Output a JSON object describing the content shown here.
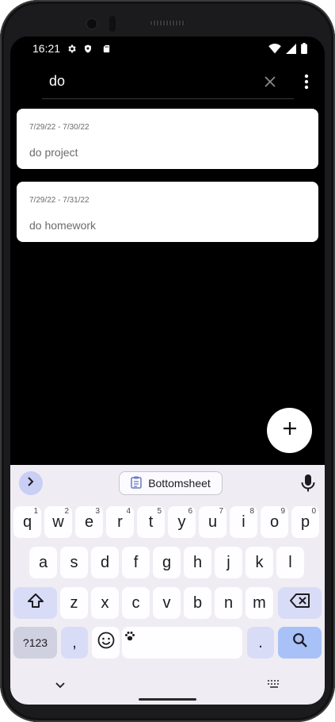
{
  "status_bar": {
    "time": "16:21",
    "icons": [
      "settings-icon",
      "shield-icon",
      "sd-card-icon",
      "wifi-icon",
      "signal-icon",
      "battery-icon"
    ]
  },
  "search": {
    "query": "do",
    "icons": [
      "close-icon",
      "more-vertical-icon"
    ]
  },
  "results": [
    {
      "dates": "7/29/22  -  7/30/22",
      "title": "do project"
    },
    {
      "dates": "7/29/22  -  7/31/22",
      "title": "do homework"
    }
  ],
  "fab": {
    "icon": "plus-icon"
  },
  "keyboard": {
    "clipboard_chip": "Bottomsheet",
    "row1": [
      {
        "k": "q",
        "s": "1"
      },
      {
        "k": "w",
        "s": "2"
      },
      {
        "k": "e",
        "s": "3"
      },
      {
        "k": "r",
        "s": "4"
      },
      {
        "k": "t",
        "s": "5"
      },
      {
        "k": "y",
        "s": "6"
      },
      {
        "k": "u",
        "s": "7"
      },
      {
        "k": "i",
        "s": "8"
      },
      {
        "k": "o",
        "s": "9"
      },
      {
        "k": "p",
        "s": "0"
      }
    ],
    "row2": [
      "a",
      "s",
      "d",
      "f",
      "g",
      "h",
      "j",
      "k",
      "l"
    ],
    "row3": [
      "z",
      "x",
      "c",
      "v",
      "b",
      "n",
      "m"
    ],
    "symbols_key": "?123",
    "comma_key": ",",
    "period_key": ".",
    "accent_color": "#a8c1f7"
  }
}
